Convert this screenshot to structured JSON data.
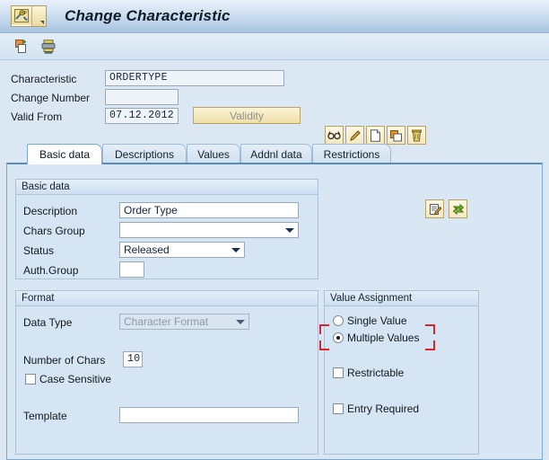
{
  "window": {
    "title": "Change Characteristic",
    "system_icon": "sap-characteristic-icon",
    "menu_arrow_icon": "chevron-down-icon"
  },
  "toolbar": {
    "buttons": [
      {
        "name": "create-copy-button",
        "icon": "copy-document-icon"
      },
      {
        "name": "print-button",
        "icon": "printer-icon"
      }
    ]
  },
  "header": {
    "fields": [
      {
        "label": "Characteristic",
        "value": "ORDERTYPE"
      },
      {
        "label": "Change Number",
        "value": ""
      },
      {
        "label": "Valid From",
        "value": "07.12.2012"
      }
    ],
    "validity_button": "Validity",
    "action_icons": [
      {
        "name": "display-button",
        "icon": "glasses-icon"
      },
      {
        "name": "change-button",
        "icon": "pencil-icon"
      },
      {
        "name": "create-button",
        "icon": "blank-page-icon"
      },
      {
        "name": "copy-button",
        "icon": "copy-icon"
      },
      {
        "name": "delete-button",
        "icon": "trash-icon"
      }
    ]
  },
  "tabs": [
    {
      "label": "Basic data",
      "active": true
    },
    {
      "label": "Descriptions",
      "active": false
    },
    {
      "label": "Values",
      "active": false
    },
    {
      "label": "Addnl data",
      "active": false
    },
    {
      "label": "Restrictions",
      "active": false
    }
  ],
  "basic_data": {
    "title": "Basic data",
    "description": {
      "label": "Description",
      "value": "Order Type"
    },
    "chars_group": {
      "label": "Chars Group",
      "value": ""
    },
    "status": {
      "label": "Status",
      "value": "Released"
    },
    "auth_group": {
      "label": "Auth.Group",
      "value": ""
    },
    "side_icons": [
      {
        "name": "documentation-button",
        "icon": "note-pencil-icon"
      },
      {
        "name": "translate-button",
        "icon": "green-arrows-icon"
      }
    ]
  },
  "format": {
    "title": "Format",
    "data_type": {
      "label": "Data Type",
      "value": "Character Format",
      "disabled": true
    },
    "number_of_chars": {
      "label": "Number of Chars",
      "value": "10"
    },
    "case_sensitive": {
      "label": "Case Sensitive",
      "checked": false
    },
    "template": {
      "label": "Template",
      "value": ""
    }
  },
  "value_assignment": {
    "title": "Value Assignment",
    "single_value": {
      "label": "Single Value",
      "selected": false
    },
    "multiple_values": {
      "label": "Multiple Values",
      "selected": true
    },
    "restrictable": {
      "label": "Restrictable",
      "checked": false
    },
    "entry_required": {
      "label": "Entry Required",
      "checked": false
    },
    "highlight_color": "#d7262f"
  }
}
